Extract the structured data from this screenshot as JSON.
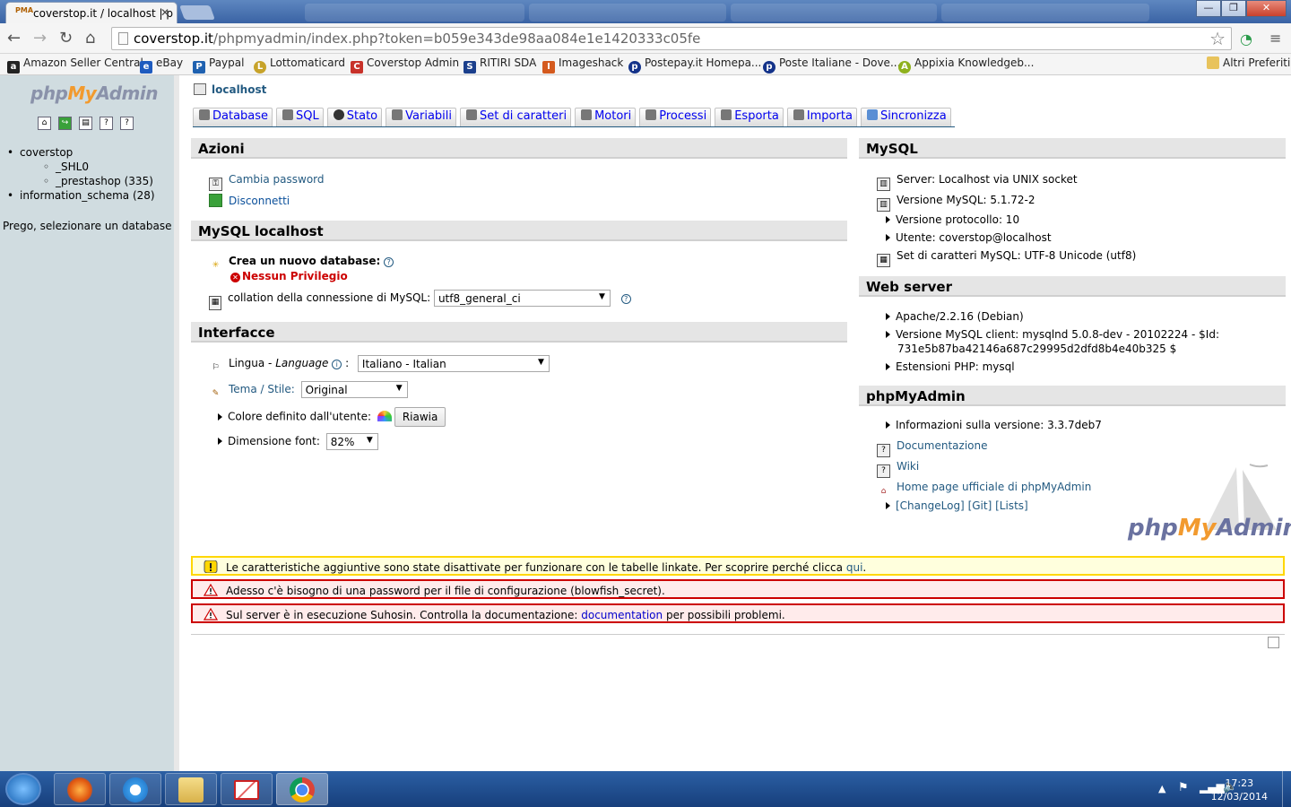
{
  "browser": {
    "tab_title": "coverstop.it / localhost | p",
    "tab_favicon": "PMA",
    "url_host": "coverstop.it",
    "url_path": "/phpmyadmin/index.php?token=b059e343de98aa084e1e1420333c05fe",
    "bookmarks": [
      {
        "label": "Amazon Seller Central",
        "color": "#222222",
        "glyph": "a"
      },
      {
        "label": "eBay",
        "color": "#1e5bbf",
        "glyph": "e"
      },
      {
        "label": "Paypal",
        "color": "#1f61b0",
        "glyph": "P"
      },
      {
        "label": "Lottomaticard",
        "color": "#c7a32a",
        "glyph": "L"
      },
      {
        "label": "Coverstop Admin",
        "color": "#c8322a",
        "glyph": "C"
      },
      {
        "label": "RITIRI SDA",
        "color": "#1b3f8c",
        "glyph": "S"
      },
      {
        "label": "Imageshack",
        "color": "#d45a1e",
        "glyph": "I"
      },
      {
        "label": "Postepay.it Homepa...",
        "color": "#14338a",
        "glyph": "p"
      },
      {
        "label": "Poste Italiane - Dove...",
        "color": "#14338a",
        "glyph": "p"
      },
      {
        "label": "Appixia Knowledgeb...",
        "color": "#8fb11e",
        "glyph": "A"
      }
    ],
    "other_bookmarks": "Altri Preferiti"
  },
  "left": {
    "logo": {
      "php": "php",
      "my": "My",
      "admin": "Admin"
    },
    "databases": [
      {
        "label": "coverstop",
        "children": [
          "_SHL0",
          "_prestashop (335)"
        ]
      },
      {
        "label": "information_schema (28)",
        "children": []
      }
    ],
    "prompt": "Prego, selezionare un database"
  },
  "main": {
    "crumb": "localhost",
    "tabs": [
      "Database",
      "SQL",
      "Stato",
      "Variabili",
      "Set di caratteri",
      "Motori",
      "Processi",
      "Esporta",
      "Importa",
      "Sincronizza"
    ],
    "azioni": {
      "title": "Azioni",
      "change_password": "Cambia password",
      "logout": "Disconnetti"
    },
    "mysql_local": {
      "title": "MySQL localhost",
      "create_db": "Crea un nuovo database:",
      "no_priv": "Nessun Privilegio",
      "collation_label": "collation della connessione di MySQL:",
      "collation_value": "utf8_general_ci"
    },
    "interface": {
      "title": "Interfacce",
      "lang_label": "Lingua -",
      "lang_label_en": "Language",
      "lang_value": "Italiano - Italian",
      "theme_label": "Tema / Stile:",
      "theme_value": "Original",
      "color_label": "Colore definito dall'utente:",
      "reset_label": "Riawia",
      "font_label": "Dimensione font:",
      "font_value": "82%"
    },
    "mysql": {
      "title": "MySQL",
      "server": "Server: Localhost via UNIX socket",
      "version": "Versione MySQL: 5.1.72-2",
      "protocol": "Versione protocollo: 10",
      "user": "Utente: coverstop@localhost",
      "charset": "Set di caratteri MySQL: UTF-8 Unicode (utf8)"
    },
    "webserver": {
      "title": "Web server",
      "apache": "Apache/2.2.16 (Debian)",
      "client_line1": "Versione MySQL client: mysqlnd 5.0.8-dev - 20102224 - $Id:",
      "client_line2": "731e5b87ba42146a687c29995d2dfd8b4e40b325 $",
      "php_ext": "Estensioni PHP: mysql"
    },
    "pma": {
      "title": "phpMyAdmin",
      "version": "Informazioni sulla versione: 3.3.7deb7",
      "docs": "Documentazione",
      "wiki": "Wiki",
      "home": "Home page ufficiale di phpMyAdmin",
      "changelog": "[ChangeLog]",
      "git": "[Git]",
      "lists": "[Lists]"
    },
    "notices": {
      "n1_text": "Le caratteristiche aggiuntive sono state disattivate per funzionare con le tabelle linkate. Per scoprire perché clicca",
      "n1_link": "qui",
      "n1_end": ".",
      "n2_text": "Adesso c'è bisogno di una password per il file di configurazione (blowfish_secret).",
      "n3_text": "Sul server è in esecuzione Suhosin. Controlla la documentazione:",
      "n3_link": "documentation",
      "n3_end": "per possibili problemi."
    },
    "watermark": {
      "php": "php",
      "my": "My",
      "admin": "Admin"
    }
  },
  "taskbar": {
    "time": "17:23",
    "date": "12/03/2014"
  },
  "colors": {
    "link": "#235a81",
    "warning_border": "#ffd700",
    "error_border": "#cc0000",
    "nav_bg": "#d0dce0"
  }
}
